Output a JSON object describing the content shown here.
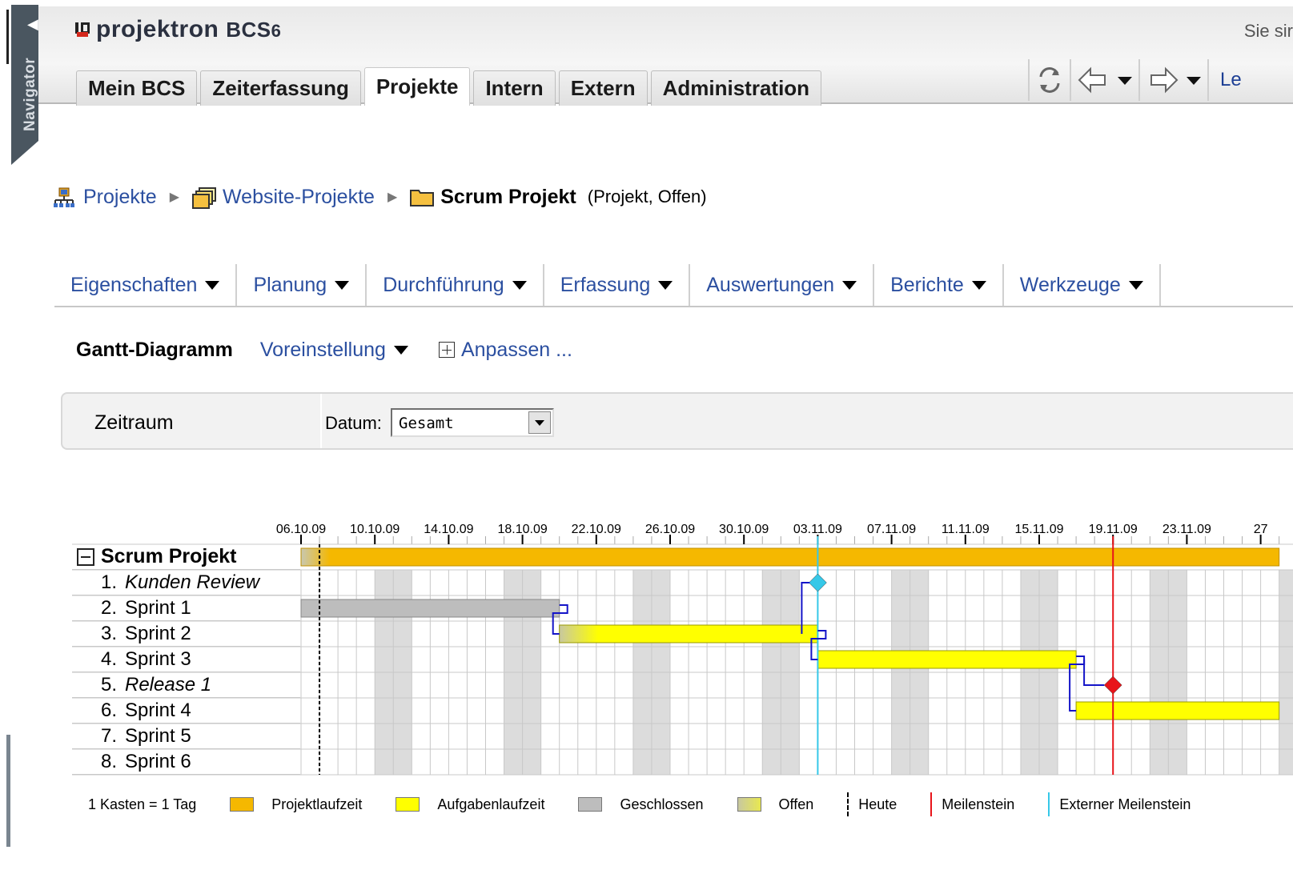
{
  "navigator": {
    "label": "Navigator",
    "arrow_icon": "triangle-left-icon"
  },
  "header": {
    "logo_text": "projektron",
    "logo_suffix": "BCS",
    "logo_version": "6",
    "user_text": "Sie sir",
    "link_text": "Le",
    "tabs": [
      {
        "label": "Mein BCS",
        "active": false
      },
      {
        "label": "Zeiterfassung",
        "active": false
      },
      {
        "label": "Projekte",
        "active": true
      },
      {
        "label": "Intern",
        "active": false
      },
      {
        "label": "Extern",
        "active": false
      },
      {
        "label": "Administration",
        "active": false
      }
    ]
  },
  "breadcrumb": {
    "items": [
      {
        "label": "Projekte",
        "icon": "org-chart-icon"
      },
      {
        "label": "Website-Projekte",
        "icon": "folders-icon"
      }
    ],
    "current": {
      "label": "Scrum Projekt",
      "icon": "folder-icon"
    },
    "meta": "(Projekt, Offen)"
  },
  "menubar": [
    "Eigenschaften",
    "Planung",
    "Durchführung",
    "Erfassung",
    "Auswertungen",
    "Berichte",
    "Werkzeuge"
  ],
  "gantt_toolbar": {
    "title": "Gantt-Diagramm",
    "preset": "Voreinstellung",
    "customize": "Anpassen ..."
  },
  "filter": {
    "label": "Zeitraum",
    "date_label": "Datum:",
    "date_value": "Gesamt"
  },
  "chart_data": {
    "type": "gantt",
    "start_date": "2009-10-06",
    "day_ticks": [
      "06.10.09",
      "10.10.09",
      "14.10.09",
      "18.10.09",
      "22.10.09",
      "26.10.09",
      "30.10.09",
      "03.11.09",
      "07.11.09",
      "11.11.09",
      "15.11.09",
      "19.11.09",
      "23.11.09",
      "27"
    ],
    "today": "2009-10-07",
    "milestone_line": "2009-11-19",
    "external_milestone_line": "2009-11-03",
    "rows": [
      {
        "num": "",
        "name": "Scrum Projekt",
        "kind": "project",
        "start": "2009-10-06",
        "end": "2009-11-27"
      },
      {
        "num": "1.",
        "name": "Kunden Review",
        "kind": "external-milestone",
        "date": "2009-11-03"
      },
      {
        "num": "2.",
        "name": "Sprint 1",
        "kind": "closed",
        "start": "2009-10-06",
        "end": "2009-10-19"
      },
      {
        "num": "3.",
        "name": "Sprint 2",
        "kind": "task-open",
        "start": "2009-10-20",
        "end": "2009-11-02"
      },
      {
        "num": "4.",
        "name": "Sprint 3",
        "kind": "task",
        "start": "2009-11-03",
        "end": "2009-11-16"
      },
      {
        "num": "5.",
        "name": "Release 1",
        "kind": "milestone",
        "date": "2009-11-19"
      },
      {
        "num": "6.",
        "name": "Sprint 4",
        "kind": "task",
        "start": "2009-11-17",
        "end": "2009-11-27"
      },
      {
        "num": "7.",
        "name": "Sprint 5",
        "kind": "empty"
      },
      {
        "num": "8.",
        "name": "Sprint 6",
        "kind": "empty"
      }
    ],
    "colors": {
      "project": "#f5b800",
      "task": "#ffff00",
      "closed": "#bdbdbd",
      "weekend": "#dcdcdc",
      "milestone": "#e8141a",
      "external_milestone": "#36c8e8",
      "dependency": "#1414c8"
    }
  },
  "legend": {
    "scale": "1 Kasten = 1 Tag",
    "items": [
      {
        "label": "Projektlaufzeit",
        "color": "#f5b800"
      },
      {
        "label": "Aufgabenlaufzeit",
        "color": "#ffff00"
      },
      {
        "label": "Geschlossen",
        "color": "#bdbdbd"
      },
      {
        "label": "Offen",
        "color": "gradient"
      }
    ],
    "today": "Heute",
    "milestone": "Meilenstein",
    "external_milestone": "Externer Meilenstein"
  }
}
